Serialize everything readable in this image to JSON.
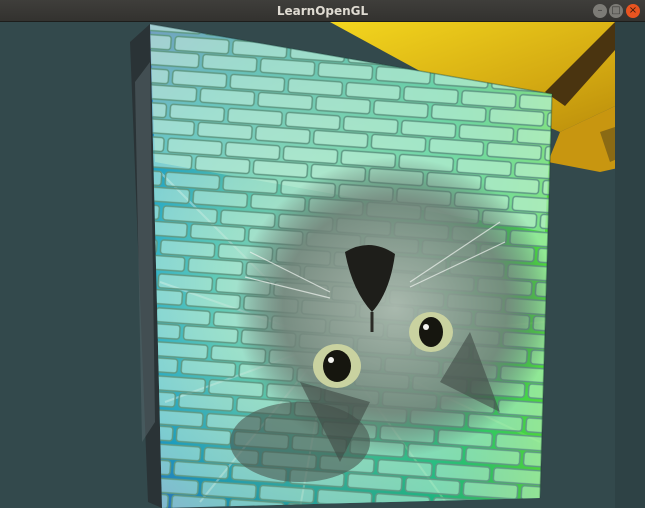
{
  "window": {
    "title": "LearnOpenGL",
    "controls": {
      "minimize_glyph": "–",
      "maximize_glyph": "□",
      "close_glyph": "×"
    }
  },
  "scene": {
    "clear_color": "#33494c",
    "brick_texture_tint": "#a8e8c8",
    "cat_texture": "awesomeface-cat",
    "side_object_color": "#e8c81c"
  }
}
